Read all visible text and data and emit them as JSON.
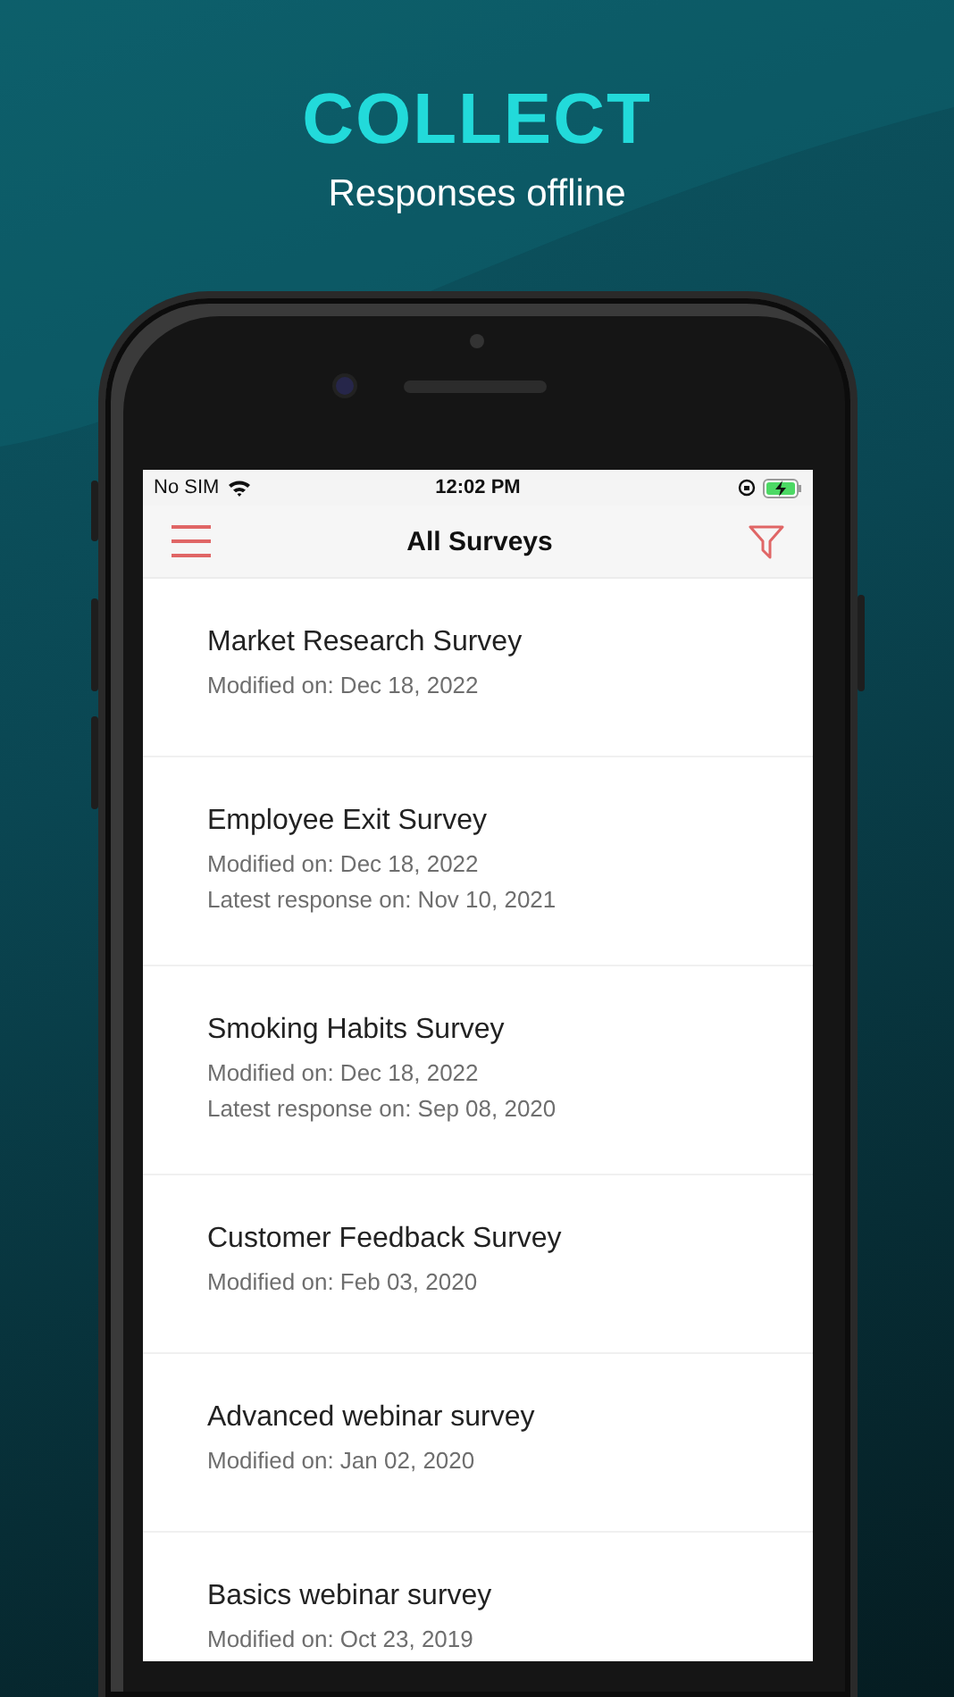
{
  "headline": "COLLECT",
  "subheadline": "Responses offline",
  "status_bar": {
    "carrier": "No SIM",
    "time": "12:02 PM"
  },
  "nav": {
    "title": "All Surveys"
  },
  "surveys": [
    {
      "title": "Market Research Survey",
      "modified": "Modified on: Dec 18, 2022"
    },
    {
      "title": "Employee Exit Survey",
      "modified": "Modified on: Dec 18, 2022",
      "latest_response": "Latest response on: Nov 10, 2021"
    },
    {
      "title": "Smoking Habits Survey",
      "modified": "Modified on: Dec 18, 2022",
      "latest_response": "Latest response on: Sep 08, 2020"
    },
    {
      "title": "Customer Feedback Survey",
      "modified": "Modified on: Feb 03, 2020"
    },
    {
      "title": "Advanced webinar survey",
      "modified": "Modified on: Jan 02, 2020"
    },
    {
      "title": "Basics webinar survey",
      "modified": "Modified on: Oct 23, 2019"
    }
  ]
}
